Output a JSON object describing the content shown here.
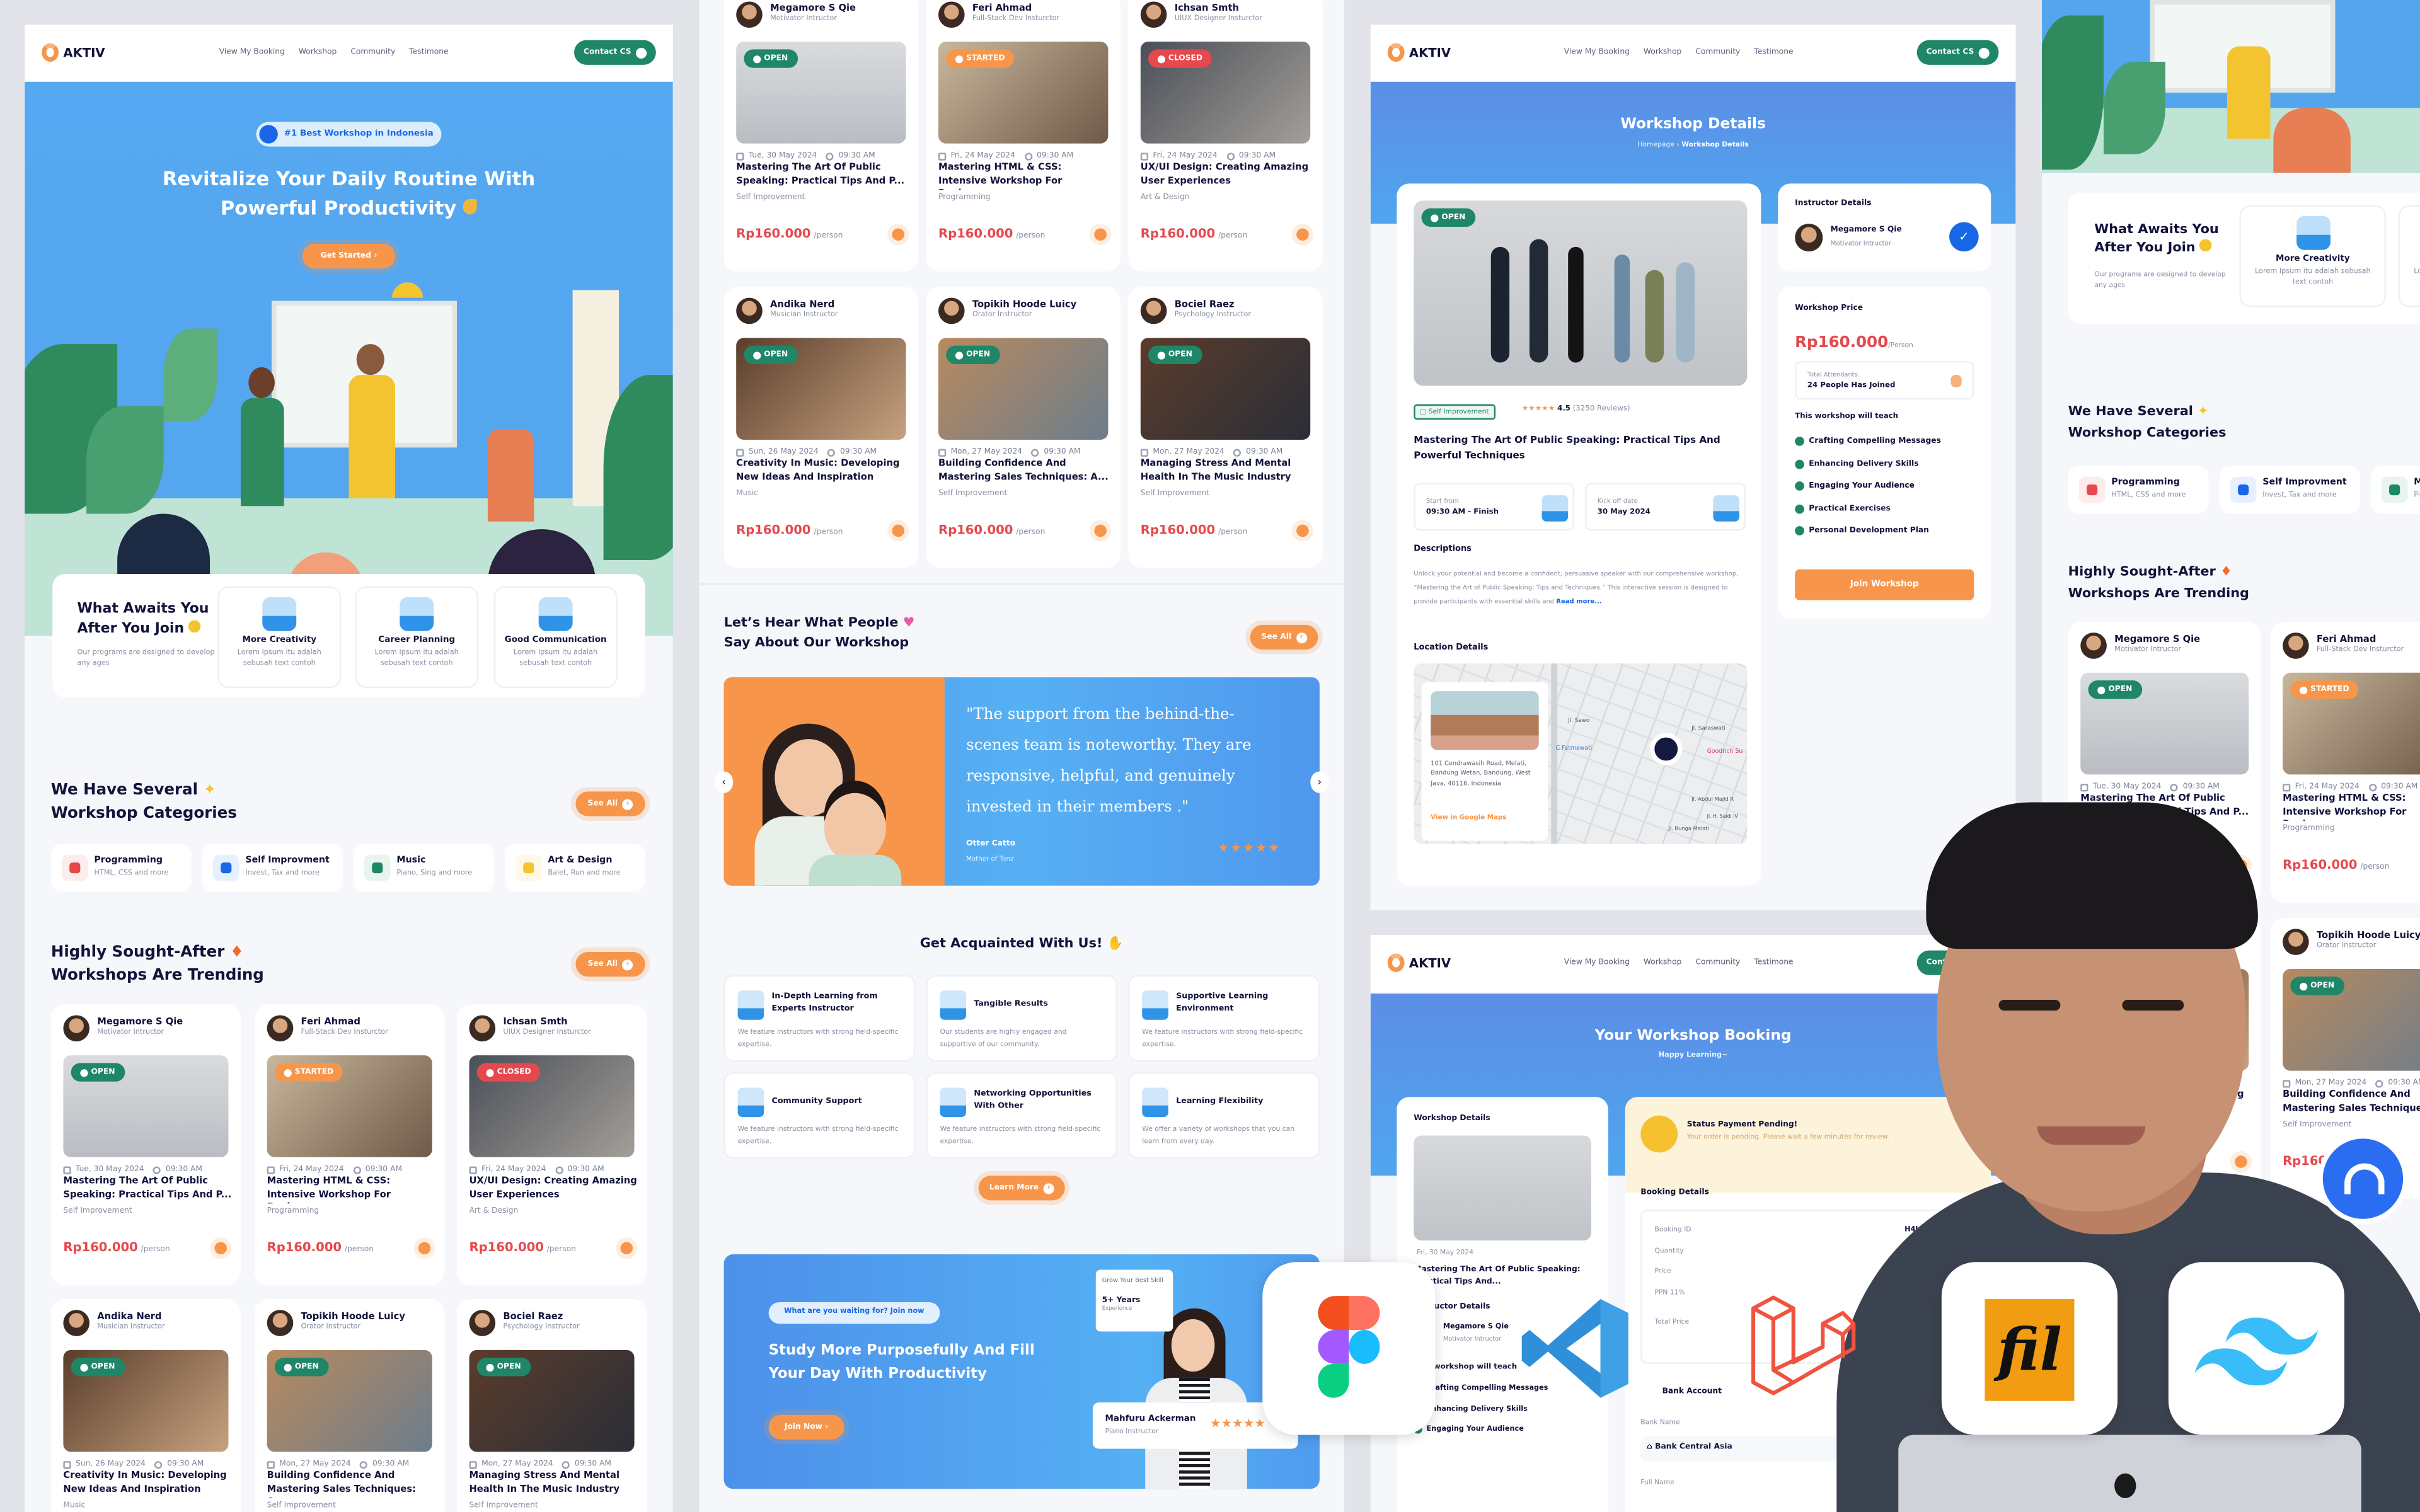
{
  "brand": "AKTIV",
  "nav": {
    "links": [
      "View My Booking",
      "Workshop",
      "Community",
      "Testimone"
    ],
    "contact": "Contact CS"
  },
  "colors": {
    "accent_orange": "#f7964a",
    "brand_green": "#1f8667",
    "hero_blue": "#52a3ee",
    "price_red": "#e5484d",
    "navy_text": "#111338"
  },
  "home": {
    "badge": "#1 Best Workshop in Indonesia",
    "hero_line1": "Revitalize Your Daily Routine With",
    "hero_line2": "Powerful Productivity",
    "get_started": "Get Started ›",
    "awaits_title1": "What Awaits You",
    "awaits_title2": "After You Join",
    "awaits_sub": "Our programs are designed to develop any ages",
    "perks": [
      {
        "name": "More Creativity",
        "desc": "Lorem Ipsum itu adalah sebusah text contoh"
      },
      {
        "name": "Career Planning",
        "desc": "Lorem Ipsum itu adalah sebusah text contoh"
      },
      {
        "name": "Good Communication",
        "desc": "Lorem Ipsum itu adalah sebusah text contoh"
      }
    ],
    "categories_title1": "We Have Several",
    "categories_title2": "Workshop Categories",
    "see_all": "See All",
    "categories": [
      {
        "name": "Programming",
        "desc": "HTML, CSS and more",
        "color": "#fdecec",
        "icon": "code-icon"
      },
      {
        "name": "Self Improvment",
        "desc": "Invest, Tax and more",
        "color": "#e7f0ff",
        "icon": "wallet-icon"
      },
      {
        "name": "Music",
        "desc": "Piano, Sing and more",
        "color": "#e8f4ee",
        "icon": "music-note-icon"
      },
      {
        "name": "Art & Design",
        "desc": "Balet, Run and more",
        "color": "#fff8e4",
        "icon": "pen-tool-icon"
      }
    ],
    "trending_title1": "Highly Sought-After",
    "trending_title2": "Workshops Are Trending"
  },
  "workshops": [
    {
      "instructor": "Megamore S Qie",
      "role": "Motivator Intructor",
      "status": "OPEN",
      "date": "Tue, 30 May 2024",
      "time": "09:30 AM",
      "title": "Mastering The Art Of Public Speaking: Practical Tips And P...",
      "category": "Self Improvement",
      "price": "Rp160.000",
      "unit": "/person"
    },
    {
      "instructor": "Feri Ahmad",
      "role": "Full-Stack Dev Insturctor",
      "status": "STARTED",
      "date": "Fri, 24 May 2024",
      "time": "09:30 AM",
      "title": "Mastering HTML & CSS: Intensive Workshop For Beginn...",
      "category": "Programming",
      "price": "Rp160.000",
      "unit": "/person"
    },
    {
      "instructor": "Ichsan Smth",
      "role": "UIUX Designer Insturctor",
      "status": "CLOSED",
      "date": "Fri, 24 May 2024",
      "time": "09:30 AM",
      "title": "UX/UI Design: Creating Amazing User Experiences",
      "category": "Art & Design",
      "price": "Rp160.000",
      "unit": "/person"
    },
    {
      "instructor": "Andika Nerd",
      "role": "Musician Instructor",
      "status": "OPEN",
      "date": "Sun, 26 May 2024",
      "time": "09:30 AM",
      "title": "Creativity In Music: Developing New Ideas And Inspiration",
      "category": "Music",
      "price": "Rp160.000",
      "unit": "/person"
    },
    {
      "instructor": "Topikih Hoode Luicy",
      "role": "Orator Instructor",
      "status": "OPEN",
      "date": "Mon, 27 May 2024",
      "time": "09:30 AM",
      "title": "Building Confidence And Mastering Sales Techniques: A...",
      "category": "Self Improvement",
      "price": "Rp160.000",
      "unit": "/person"
    },
    {
      "instructor": "Bociel Raez",
      "role": "Psychology Instructor",
      "status": "OPEN",
      "date": "Mon, 27 May 2024",
      "time": "09:30 AM",
      "title": "Managing Stress And Mental Health In The Music Industry",
      "category": "Self Improvement",
      "price": "Rp160.000",
      "unit": "/person"
    }
  ],
  "testimonial": {
    "title1": "Let’s Hear What People",
    "title2": "Say About Our Workshop",
    "see_all": "See All",
    "quote": "\"The support from the behind-the-scenes team is noteworthy. They are responsive, helpful, and genuinely invested in their members .\"",
    "name": "Otter Catto",
    "relation": "Mother of Tenz",
    "rating": 5
  },
  "acquainted": {
    "title": "Get Acquainted With Us!",
    "items": [
      {
        "name": "In-Depth Learning from Experts Instructor",
        "desc": "We feature instructors with strong field-specific expertise."
      },
      {
        "name": "Tangible Results",
        "desc": "Our students are highly engaged and supportive of our community."
      },
      {
        "name": "Supportive Learning Environment",
        "desc": "We feature instructors with strong field-specific expertise."
      },
      {
        "name": "Community Support",
        "desc": "We feature instructors with strong field-specific expertise."
      },
      {
        "name": "Networking Opportunities With Other",
        "desc": "We feature instructors with strong field-specific expertise."
      },
      {
        "name": "Learning Flexibility",
        "desc": "We offer a variety of workshops that you can learn from every day."
      }
    ],
    "learn_more": "Learn More"
  },
  "cta": {
    "pill": "What are you waiting for? Join now",
    "line1": "Study More Purposefully And Fill",
    "line2": "Your Day With Productivity",
    "join": "Join Now ›",
    "skill_label": "Grow Your Best Skill",
    "years": "5+ Years",
    "experience": "Experience",
    "instructor": "Mahfuru Ackerman",
    "instructor_role": "Piano Instructor"
  },
  "detail": {
    "title": "Workshop Details",
    "breadcrumb": [
      "Homepage",
      "Workshop Details"
    ],
    "status": "OPEN",
    "category": "Self Improvement",
    "rating": "4.5",
    "reviews": "(3250 Reviews)",
    "workshop_title": "Mastering The Art Of Public Speaking: Practical Tips And Powerful Techniques",
    "start_label": "Start from",
    "start_value": "09:30 AM - Finish",
    "kickoff_label": "Kick off date",
    "kickoff_value": "30 May 2024",
    "desc_title": "Descriptions",
    "desc": "Unlock your potential and become a confident, persuasive speaker with our comprehensive workshop, “Mastering the Art of Public Speaking: Tips and Techniques.” This interactive session is designed to provide participants with essential skills and ",
    "read_more": "Read more...",
    "location_title": "Location Details",
    "address": "101 Cendrawasih Road, Melati, Bandung Wetan, Bandung, West Java, 40116, Indonesia",
    "maps_link": "View in Google Maps",
    "map_labels": [
      "Jl. Sawo",
      "Jl. Saraswati",
      "C Fatmawati",
      "Goodrich Su",
      "Jl. Abdul Majid R",
      "Jl. Bunga Melati",
      "Jl. H. Saidi IV"
    ],
    "instructor_title": "Instructor Details",
    "instructor": "Megamore S Qie",
    "instructor_role": "Motivator Intructor",
    "price_title": "Workshop Price",
    "price": "Rp160.000",
    "price_unit": "/Person",
    "attendants_label": "Total Attendants:",
    "attendants_value": "24 People Has Joined",
    "teach_title": "This workshop will teach",
    "teach": [
      "Crafting Compelling Messages",
      "Enhancing Delivery Skills",
      "Engaging Your Audience",
      "Practical Exercises",
      "Personal Development Plan"
    ],
    "join": "Join Workshop"
  },
  "booking": {
    "title": "Your Workshop Booking",
    "subtitle": "Happy Learning~",
    "details_title": "Workshop Details",
    "date": "Fri, 30 May 2024",
    "workshop_title": "Mastering The Art Of Public Speaking: Practical Tips And...",
    "instructor_title": "Instructor Details",
    "instructor": "Megamore S Qie",
    "instructor_role": "Motivator Intructor",
    "teach_title": "This workshop will teach",
    "teach": [
      "Crafting Compelling Messages",
      "Enhancing Delivery Skills",
      "Engaging Your Audience"
    ],
    "status_title": "Status Payment Pending!",
    "status_desc": "Your order is pending. Please wait a few minutes for review.",
    "booking_title": "Booking Details",
    "rows": [
      "Booking ID",
      "Quantity",
      "Price",
      "PPN 11%",
      "Total Price"
    ],
    "booking_id": "H4L04CT",
    "bank_title": "Bank Account",
    "bank_name_label": "Bank Name",
    "bank_name": "Bank Central Asia",
    "full_name_label": "Full Name"
  },
  "overlay_logos": [
    "figma-logo",
    "vscode-logo",
    "laravel-logo",
    "filament-logo",
    "tailwind-logo",
    "brand-circle-logo"
  ],
  "filament_mark": "fil"
}
